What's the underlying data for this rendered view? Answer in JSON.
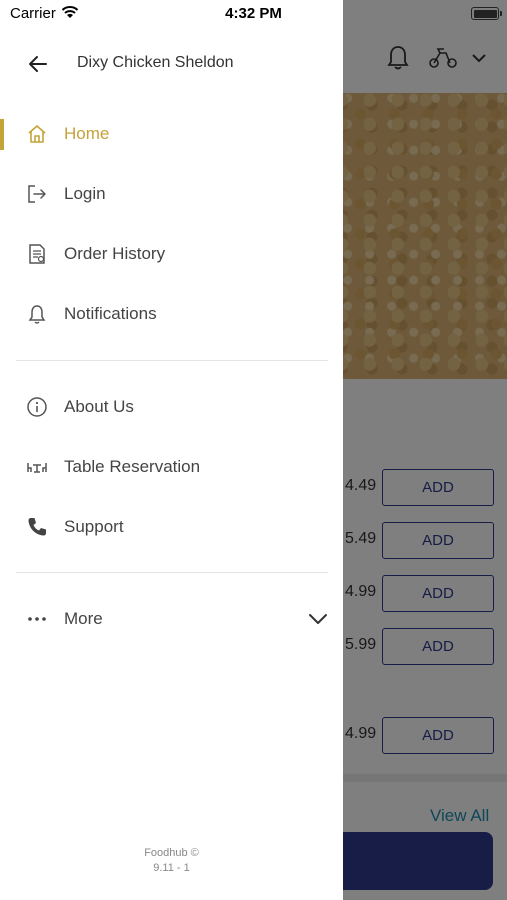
{
  "status_bar": {
    "carrier": "Carrier",
    "time": "4:32 PM"
  },
  "drawer": {
    "restaurant_name": "Dixy Chicken Sheldon",
    "items": [
      {
        "label": "Home",
        "icon": "home-icon",
        "active": true
      },
      {
        "label": "Login",
        "icon": "login-icon"
      },
      {
        "label": "Order History",
        "icon": "order-history-icon"
      },
      {
        "label": "Notifications",
        "icon": "bell-icon"
      },
      {
        "label": "About Us",
        "icon": "info-icon"
      },
      {
        "label": "Table Reservation",
        "icon": "table-reservation-icon"
      },
      {
        "label": "Support",
        "icon": "phone-icon"
      },
      {
        "label": "More",
        "icon": "more-dots-icon"
      }
    ],
    "footer": {
      "brand": "Foodhub ©",
      "version": "9.11 - 1"
    },
    "accent_color": "#c4a339"
  },
  "background": {
    "prices": [
      "4.49",
      "5.49",
      "4.99",
      "5.99",
      "4.99"
    ],
    "add_label": "ADD",
    "view_all": "View All"
  }
}
